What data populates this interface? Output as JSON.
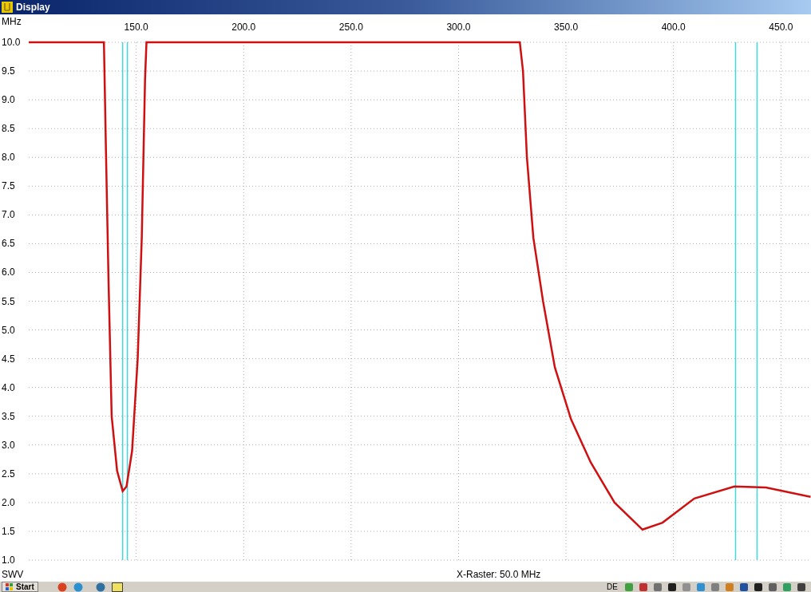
{
  "window": {
    "title": "Display"
  },
  "plot": {
    "raster": "X-Raster: 50.0 MHz",
    "chart_data": {
      "type": "line",
      "xlabel": "MHz",
      "ylabel": "SWV",
      "grid": true,
      "xlim": [
        100,
        464
      ],
      "ylim": [
        1,
        10
      ],
      "xticks": [
        {
          "value": 150,
          "label": "150.0"
        },
        {
          "value": 200,
          "label": "200.0"
        },
        {
          "value": 250,
          "label": "250.0"
        },
        {
          "value": 300,
          "label": "300.0"
        },
        {
          "value": 350,
          "label": "350.0"
        },
        {
          "value": 400,
          "label": "400.0"
        },
        {
          "value": 450,
          "label": "450.0"
        }
      ],
      "yticks": [
        {
          "value": 1,
          "label": "1.0"
        },
        {
          "value": 1.5,
          "label": "1.5"
        },
        {
          "value": 2,
          "label": "2.0"
        },
        {
          "value": 2.5,
          "label": "2.5"
        },
        {
          "value": 3,
          "label": "3.0"
        },
        {
          "value": 3.5,
          "label": "3.5"
        },
        {
          "value": 4,
          "label": "4.0"
        },
        {
          "value": 4.5,
          "label": "4.5"
        },
        {
          "value": 5,
          "label": "5.0"
        },
        {
          "value": 5.5,
          "label": "5.5"
        },
        {
          "value": 6,
          "label": "6.0"
        },
        {
          "value": 6.5,
          "label": "6.5"
        },
        {
          "value": 7,
          "label": "7.0"
        },
        {
          "value": 7.5,
          "label": "7.5"
        },
        {
          "value": 8,
          "label": "8.0"
        },
        {
          "value": 8.5,
          "label": "8.5"
        },
        {
          "value": 9,
          "label": "9.0"
        },
        {
          "value": 9.5,
          "label": "9.5"
        },
        {
          "value": 10,
          "label": "10.0"
        }
      ],
      "x": [
        100,
        135,
        136,
        137.1,
        138.6,
        141.1,
        143.7,
        145.5,
        148.1,
        150.7,
        152.6,
        154.1,
        154.8,
        328.5,
        330,
        331.8,
        334.8,
        339.3,
        344.8,
        352.3,
        361.5,
        372.6,
        385.6,
        394.9,
        409.7,
        428.3,
        443,
        463.8
      ],
      "series": [
        {
          "color": "#d01010",
          "values": [
            10,
            10,
            8.0,
            5.9,
            3.5,
            2.55,
            2.2,
            2.28,
            2.9,
            4.5,
            6.6,
            9.35,
            10,
            10,
            9.5,
            8.0,
            6.6,
            5.5,
            4.35,
            3.45,
            2.7,
            2.0,
            1.53,
            1.65,
            2.07,
            2.28,
            2.26,
            2.1
          ]
        }
      ],
      "ref_lines": [
        {
          "axis": "x",
          "value": 143.7,
          "color": "#40d8e0"
        },
        {
          "axis": "x",
          "value": 145.9,
          "color": "#40d8e0"
        },
        {
          "axis": "x",
          "value": 428.9,
          "color": "#40d8e0"
        },
        {
          "axis": "x",
          "value": 438.9,
          "color": "#40d8e0"
        }
      ]
    }
  },
  "taskbar": {
    "start": "Start",
    "language": "DE"
  }
}
